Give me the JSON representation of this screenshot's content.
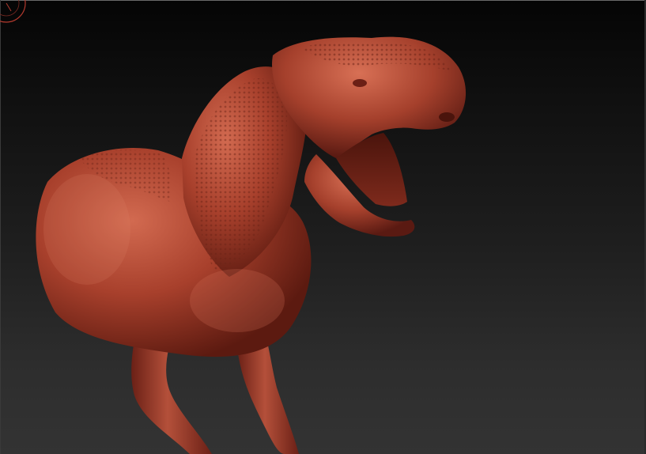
{
  "viewport": {
    "background_top": "#050505",
    "background_bottom": "#333333",
    "frame_color": "#6a6a6a"
  },
  "gizmo": {
    "icon": "orientation-gizmo-icon",
    "color": "#c0392b"
  },
  "model": {
    "icon": "trex-sculpt",
    "material_color": "#a8402c",
    "material_shadow": "#5c1a10",
    "material_highlight": "#d86a4f"
  }
}
